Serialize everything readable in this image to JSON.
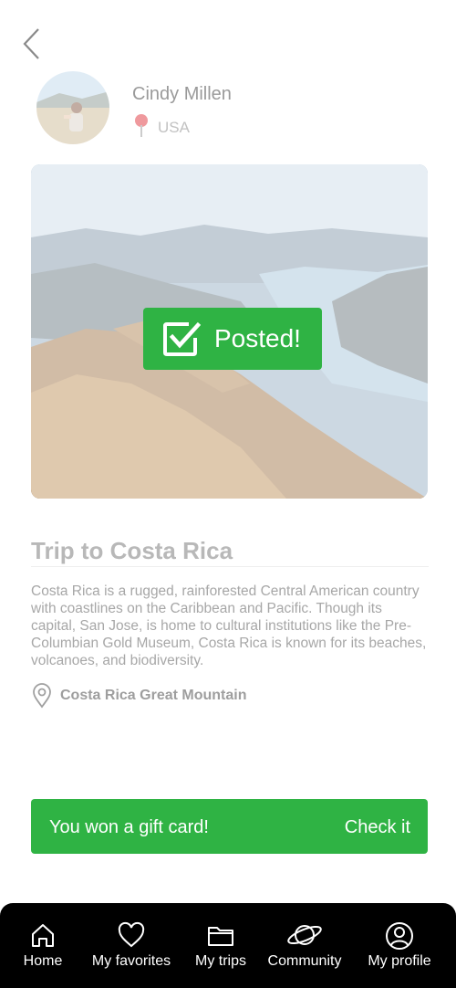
{
  "profile": {
    "name": "Cindy Millen",
    "location": "USA"
  },
  "post": {
    "status": "Posted!",
    "title": "Trip to Costa Rica",
    "description": "Costa Rica is a rugged, rainforested Central American country with coastlines on the Caribbean and Pacific. Though its capital, San Jose, is home to cultural institutions like the Pre-Columbian Gold Museum, Costa Rica is known for its beaches, volcanoes, and biodiversity.",
    "place": "Costa Rica Great Mountain"
  },
  "gift": {
    "message": "You won a gift card!",
    "action": "Check it"
  },
  "nav": {
    "items": [
      {
        "label": "Home",
        "icon": "home-icon"
      },
      {
        "label": "My favorites",
        "icon": "heart-icon"
      },
      {
        "label": "My trips",
        "icon": "folder-icon"
      },
      {
        "label": "Community",
        "icon": "planet-icon"
      },
      {
        "label": "My profile",
        "icon": "user-circle-icon"
      }
    ]
  },
  "colors": {
    "accent": "#2fb344",
    "tabbar": "#000000"
  }
}
